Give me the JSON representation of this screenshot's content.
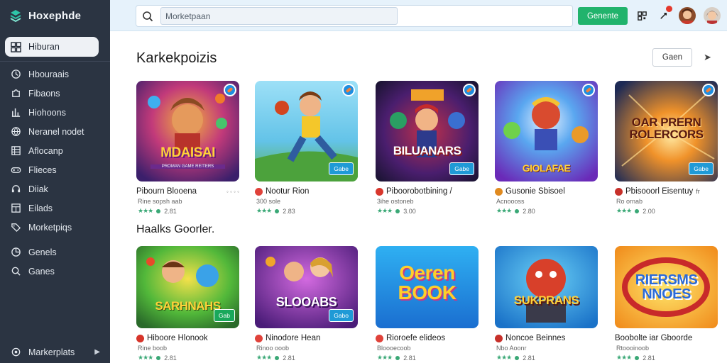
{
  "colors": {
    "sidebar_bg": "#2b3442",
    "topbar_bg": "#e6f2fb",
    "accent_green": "#21b36c",
    "badge_blue": "#1f8ee0"
  },
  "brand": {
    "name": "Hoxephde",
    "icon": "stack-logo-icon"
  },
  "sidebar": {
    "active": {
      "label": "Hiburan",
      "icon": "grid-icon"
    },
    "items": [
      {
        "label": "Hbouraais",
        "icon": "clock-icon"
      },
      {
        "label": "Fibaons",
        "icon": "puzzle-icon"
      },
      {
        "label": "Hiohoons",
        "icon": "bar-chart-icon"
      },
      {
        "label": "Neranel nodet",
        "icon": "globe-icon"
      },
      {
        "label": "Aflocanp",
        "icon": "table-icon"
      },
      {
        "label": "Flieces",
        "icon": "gamepad-icon"
      },
      {
        "label": "Diiak",
        "icon": "headset-icon"
      },
      {
        "label": "Eilads",
        "icon": "window-icon"
      },
      {
        "label": "Morketpiqs",
        "icon": "tag-icon"
      },
      {
        "label": "Genels",
        "icon": "pie-icon"
      },
      {
        "label": "Ganes",
        "icon": "search-icon"
      }
    ],
    "bottom": {
      "label": "Markerplats",
      "icon": "settings-icon"
    }
  },
  "topbar": {
    "search_placeholder": "Morketpaan",
    "action_button": "Genente",
    "icons": [
      "qr-icon",
      "notification-icon",
      "avatar-1",
      "avatar-2"
    ]
  },
  "section1": {
    "title": "Karkekpoizis",
    "button": "Gaen",
    "cards": [
      {
        "art_title": "MDAISAI",
        "art_sub": "PROMAN GAME REITERS",
        "name": "Pibourn Blooena",
        "extra": "◦ ◦ ◦ ◦",
        "sub": "Rine sopsh aab",
        "rating": "2.81",
        "tag": "",
        "dot": ""
      },
      {
        "art_title": "",
        "art_sub": "",
        "name": "Nootur Rion",
        "extra": "",
        "sub": "300 sole",
        "rating": "2.83",
        "tag": "Gabe",
        "dot": "#e0423a"
      },
      {
        "art_title": "BILUANARS",
        "art_sub": "",
        "name": "Piboorobotbining /",
        "extra": "",
        "sub": "3ihe ostoneb",
        "rating": "3.00",
        "tag": "Gabe",
        "dot": "#d8362c"
      },
      {
        "art_title": "GIOLAFAE",
        "art_sub": "",
        "name": "Gusonie Sbisoel",
        "extra": "",
        "sub": "Acnoooss",
        "rating": "2.80",
        "tag": "",
        "dot": "#e08a1f"
      },
      {
        "art_title": "OAR PRERN ROLERCORS",
        "art_sub": "",
        "name": "Pbisooorl Eisentuy",
        "extra": "fr",
        "sub": "Ro ornab",
        "rating": "2.00",
        "tag": "Gabe",
        "dot": "#c7302a"
      }
    ]
  },
  "section2": {
    "title": "Haalks Goorler.",
    "cards": [
      {
        "art_title": "SARHNAHS",
        "name": "Hiboore Hlonook",
        "sub": "Rine boob",
        "rating": "2.81",
        "tag": "Gab",
        "dot": "#d7342a"
      },
      {
        "art_title": "SLOOABS",
        "name": "Ninodore Hean",
        "sub": "Rinoo ooob",
        "rating": "2.81",
        "tag": "Gabo",
        "dot": "#e0423a"
      },
      {
        "art_title": "Oeren BOOK",
        "name": "Rioroefe elideos",
        "sub": "Bloooecoob",
        "rating": "2.81",
        "tag": "",
        "dot": "#e0423a"
      },
      {
        "art_title": "SUKPRANS",
        "name": "Noncoe Beinnes",
        "sub": "Nbo Aoonr",
        "rating": "2.81",
        "tag": "",
        "dot": "#c7302a"
      },
      {
        "art_title": "RIERSMS NNOES",
        "name": "Boobolte iar Gboorde",
        "sub": "Rtoooinoob",
        "rating": "2.81",
        "tag": "",
        "dot": ""
      }
    ]
  }
}
